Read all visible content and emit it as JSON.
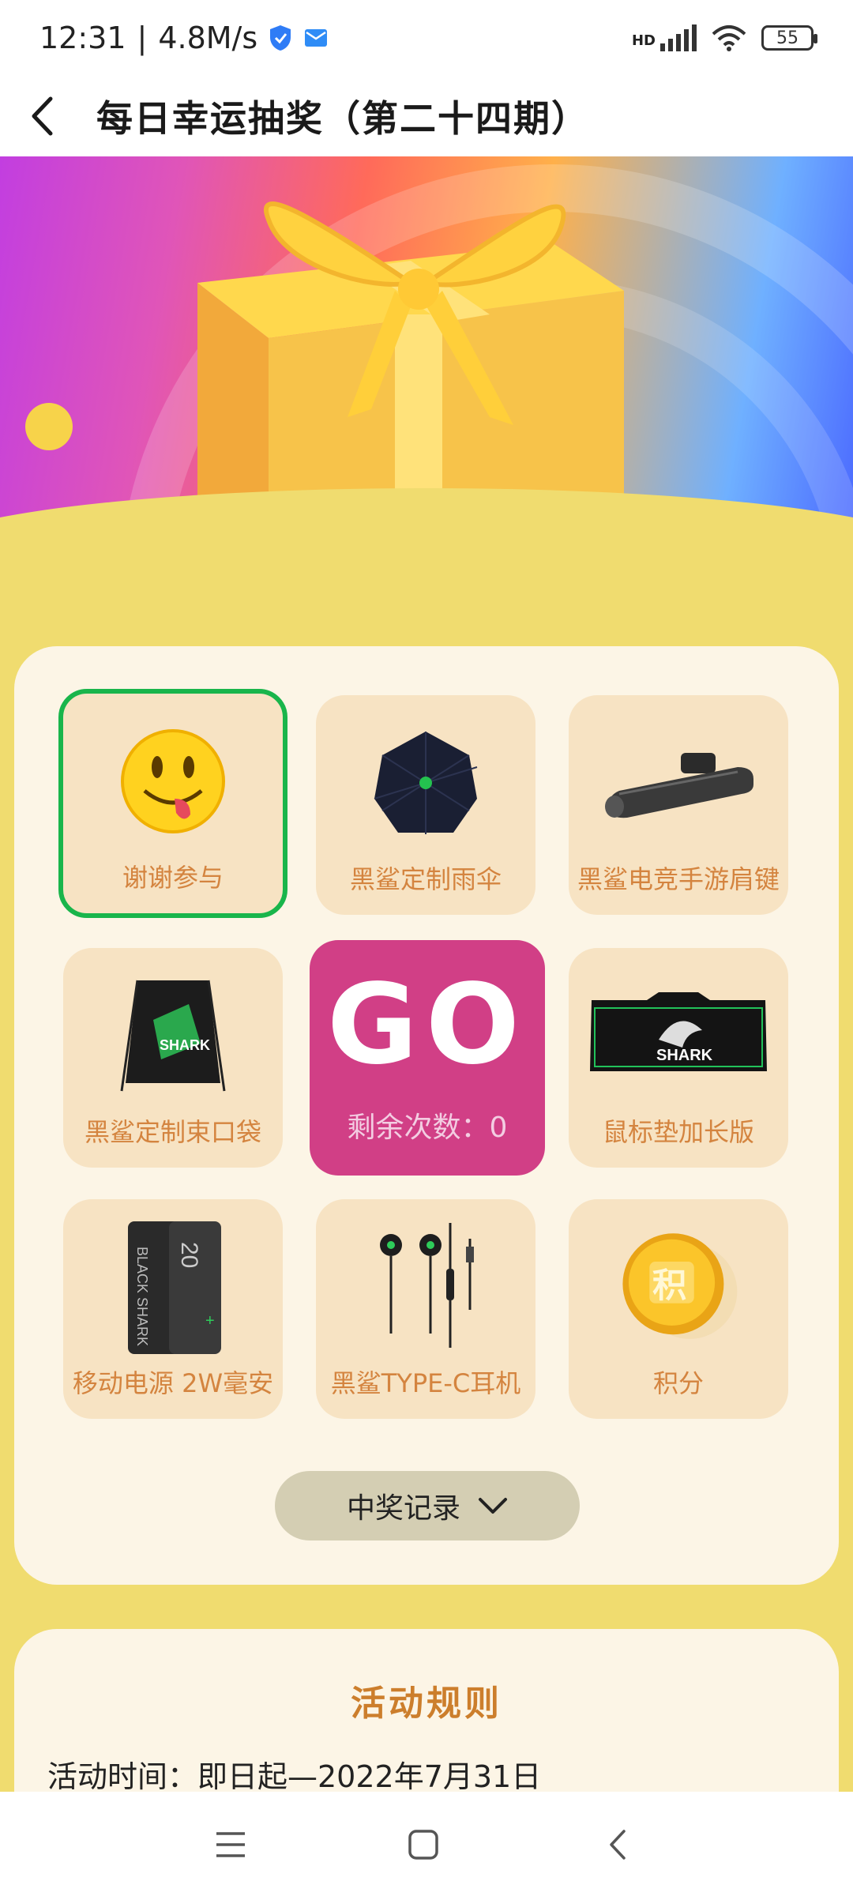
{
  "status": {
    "time": "12:31",
    "speed": "4.8M/s",
    "network": "HD",
    "battery": "55"
  },
  "header": {
    "title": "每日幸运抽奖（第二十四期）"
  },
  "prizes": [
    {
      "label": "谢谢参与",
      "icon": "smiley-tongue-icon",
      "selected": true
    },
    {
      "label": "黑鲨定制雨伞",
      "icon": "umbrella-icon"
    },
    {
      "label": "黑鲨电竞手游肩键",
      "icon": "shoulder-trigger-icon"
    },
    {
      "label": "黑鲨定制束口袋",
      "icon": "drawstring-bag-icon"
    },
    {
      "label": "鼠标垫加长版",
      "icon": "mouse-pad-icon"
    },
    {
      "label": "移动电源 2W毫安",
      "icon": "power-bank-icon"
    },
    {
      "label": "黑鲨TYPE-C耳机",
      "icon": "earphones-icon"
    },
    {
      "label": "积分",
      "icon": "points-coin-icon"
    }
  ],
  "go": {
    "text": "GO",
    "remaining": "剩余次数：0"
  },
  "record": {
    "label": "中奖记录"
  },
  "rules": {
    "title": "活动规则",
    "time": "活动时间：即日起—2022年7月31日"
  },
  "colors": {
    "background": "#f0dc6f",
    "panel": "#fcf5e6",
    "cell": "#f7e3c3",
    "label": "#d4843f",
    "go": "#d13f86",
    "selected_border": "#19b54b"
  }
}
